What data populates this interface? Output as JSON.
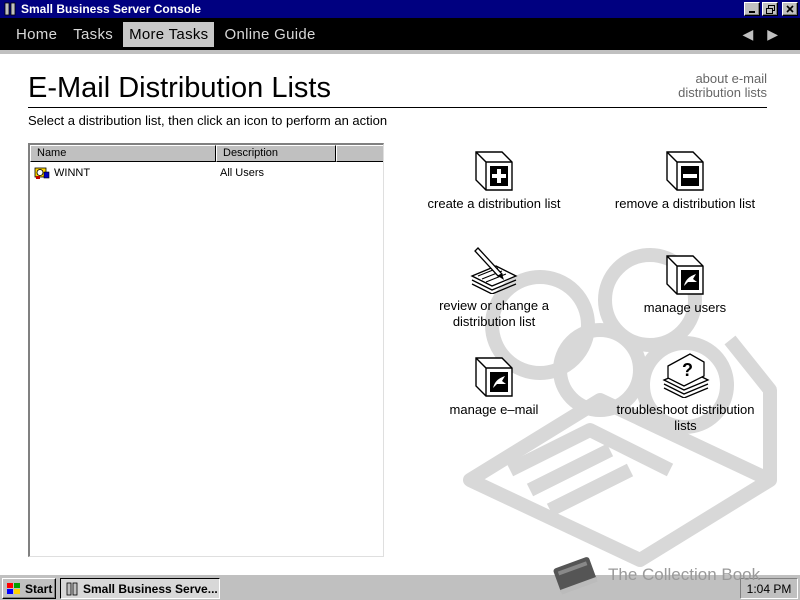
{
  "window": {
    "title": "Small Business Server Console"
  },
  "nav": {
    "items": [
      {
        "label": "Home"
      },
      {
        "label": "Tasks"
      },
      {
        "label": "More Tasks",
        "active": true
      },
      {
        "label": "Online Guide"
      }
    ]
  },
  "page": {
    "title": "E-Mail Distribution Lists",
    "about_link_line1": "about e-mail",
    "about_link_line2": "distribution lists",
    "instruction": "Select a distribution list, then click an icon to perform an action"
  },
  "list": {
    "columns": [
      "Name",
      "Description"
    ],
    "rows": [
      {
        "name": "WINNT",
        "description": "All Users"
      }
    ]
  },
  "actions": {
    "create": {
      "line1": "create a distribution list"
    },
    "remove": {
      "line1": "remove a distribution list"
    },
    "review": {
      "line1": "review or change a",
      "line2": "distribution list"
    },
    "manage_users": {
      "line1": "manage users"
    },
    "manage_email": {
      "line1": "manage e–mail"
    },
    "troubleshoot": {
      "line1": "troubleshoot distribution",
      "line2": "lists"
    }
  },
  "taskbar": {
    "start_label": "Start",
    "task_label": "Small Business Serve...",
    "clock": "1:04 PM"
  },
  "watermark_brand": {
    "text": "The Collection Book"
  },
  "colors": {
    "titlebar": "#000080",
    "navbar": "#000000",
    "nav_active": "#c8c8c8",
    "desktop_gray": "#c0c0c0"
  }
}
